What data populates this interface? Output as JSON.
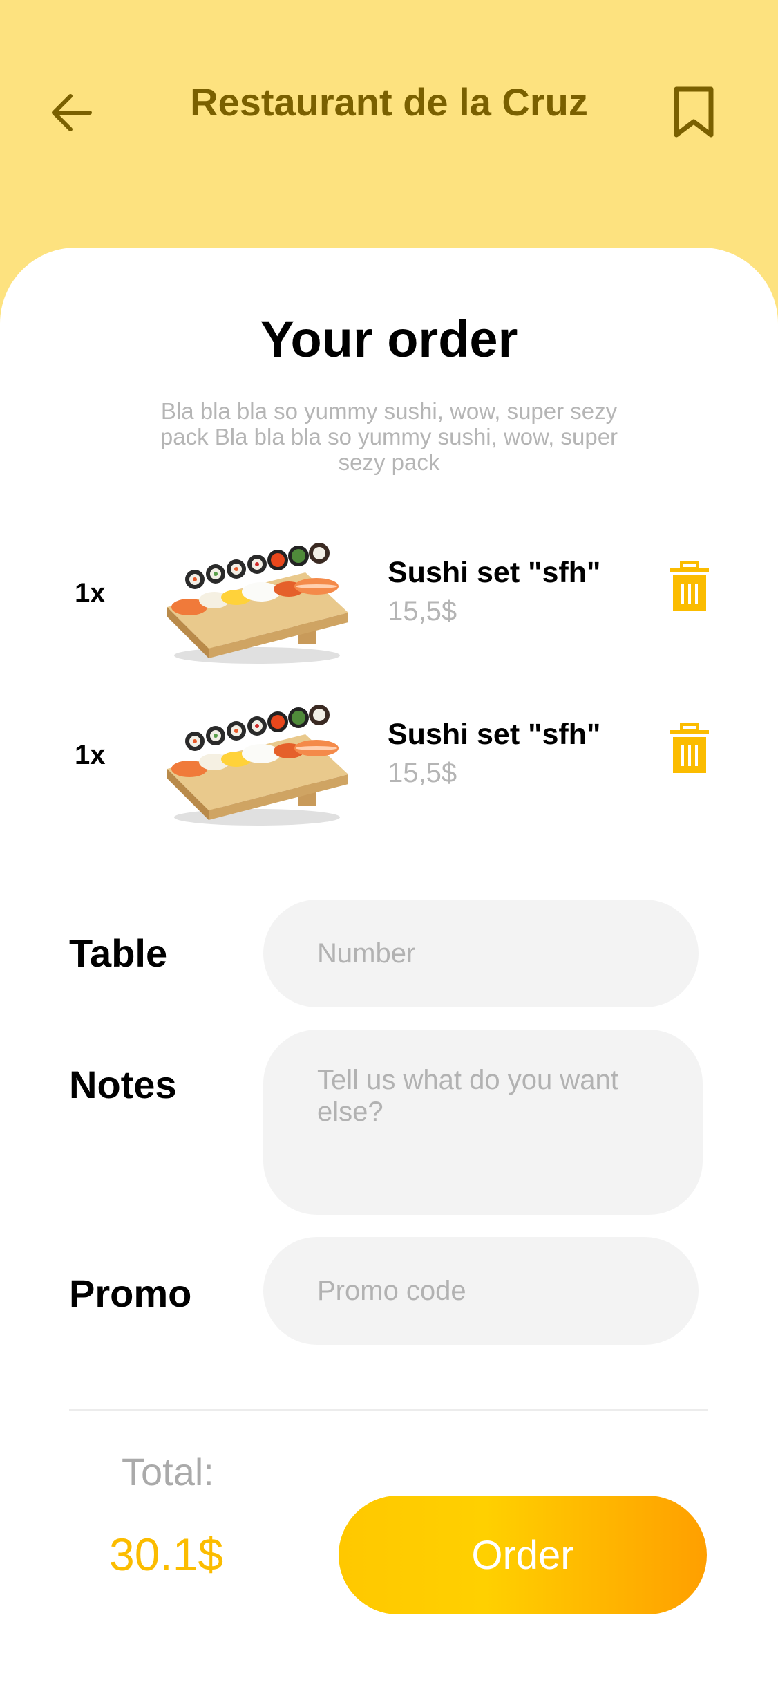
{
  "header": {
    "title": "Restaurant de la Cruz",
    "back_icon": "arrow-left-icon",
    "bookmark_icon": "bookmark-icon",
    "accent_color": "#7a6000",
    "background": "#fde27f"
  },
  "order": {
    "title": "Your order",
    "description": "Bla bla bla so yummy sushi, wow, super sezy pack Bla bla bla so yummy sushi, wow, super sezy pack"
  },
  "items": [
    {
      "qty": "1x",
      "name": "Sushi set \"sfh\"",
      "price": "15,5$",
      "image": "sushi-set-image",
      "delete_icon": "trash-icon"
    },
    {
      "qty": "1x",
      "name": "Sushi set \"sfh\"",
      "price": "15,5$",
      "image": "sushi-set-image",
      "delete_icon": "trash-icon"
    }
  ],
  "form": {
    "table_label": "Table",
    "table_placeholder": "Number",
    "notes_label": "Notes",
    "notes_placeholder": "Tell us what do you want else?",
    "promo_label": "Promo",
    "promo_placeholder": "Promo code"
  },
  "footer": {
    "total_label": "Total:",
    "total_value": "30.1$",
    "order_button": "Order",
    "accent_color": "#fbbc00"
  }
}
